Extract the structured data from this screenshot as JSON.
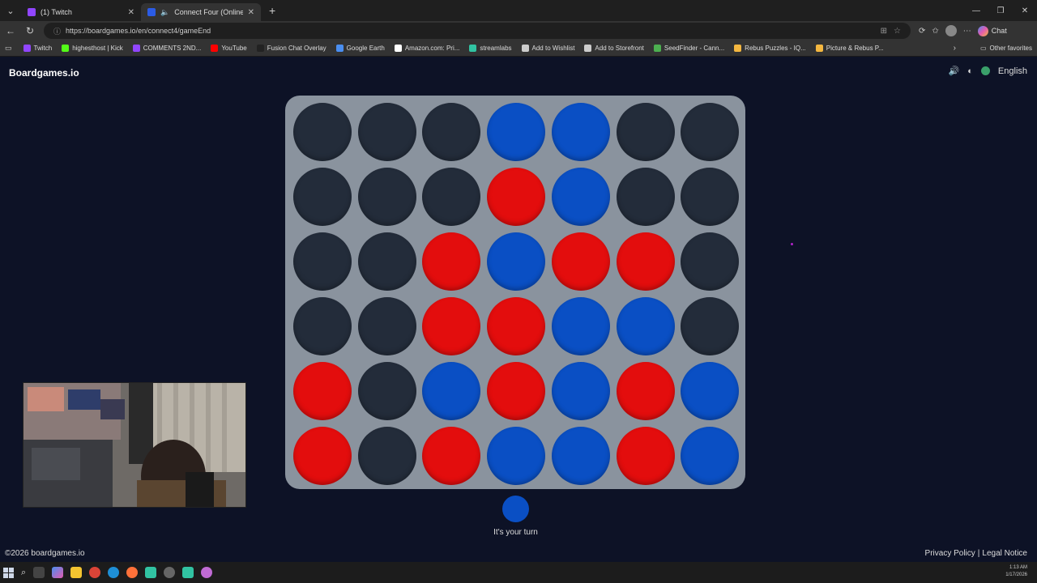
{
  "browser": {
    "tabs": [
      {
        "title": "(1) Twitch",
        "active": false,
        "favicon_color": "#9146ff"
      },
      {
        "title": "Connect Four (Online game f",
        "active": true,
        "favicon_color": "#2b5ce6"
      }
    ],
    "url": "https://boardgames.io/en/connect4/gameEnd",
    "chat_label": "Chat",
    "bookmarks": [
      {
        "label": "Twitch",
        "color": "#9146ff"
      },
      {
        "label": "highesthost | Kick",
        "color": "#53fc18"
      },
      {
        "label": "COMMENTS 2ND...",
        "color": "#9146ff"
      },
      {
        "label": "YouTube",
        "color": "#ff0000"
      },
      {
        "label": "Fusion Chat Overlay",
        "color": "#222222"
      },
      {
        "label": "Google Earth",
        "color": "#4a8ef0"
      },
      {
        "label": "Amazon.com: Pri...",
        "color": "#ffffff"
      },
      {
        "label": "streamlabs",
        "color": "#31c3a2"
      },
      {
        "label": "Add to Wishlist",
        "color": "#cccccc"
      },
      {
        "label": "Add to Storefront",
        "color": "#cccccc"
      },
      {
        "label": "SeedFinder - Cann...",
        "color": "#4caf50"
      },
      {
        "label": "Rebus Puzzles - IQ...",
        "color": "#f4b740"
      },
      {
        "label": "Picture & Rebus P...",
        "color": "#f4b740"
      }
    ],
    "other_favorites": "Other favorites"
  },
  "site": {
    "brand": "Boardgames.io",
    "language": "English",
    "copyright": "©2026 boardgames.io",
    "privacy": "Privacy Policy",
    "separator": "|",
    "legal": "Legal Notice"
  },
  "game": {
    "columns": 7,
    "rows": 6,
    "board": [
      [
        "empty",
        "empty",
        "empty",
        "blue",
        "blue",
        "empty",
        "empty"
      ],
      [
        "empty",
        "empty",
        "empty",
        "red",
        "blue",
        "empty",
        "empty"
      ],
      [
        "empty",
        "empty",
        "red",
        "blue",
        "red",
        "red",
        "empty"
      ],
      [
        "empty",
        "empty",
        "red",
        "red",
        "blue",
        "blue",
        "empty"
      ],
      [
        "red",
        "empty",
        "blue",
        "red",
        "blue",
        "red",
        "blue"
      ],
      [
        "red",
        "empty",
        "red",
        "blue",
        "blue",
        "red",
        "blue"
      ]
    ],
    "turn_color": "blue",
    "turn_text": "It's your turn",
    "colors": {
      "red": "#e30d0d",
      "blue": "#0a4fc4",
      "empty": "#232c3a",
      "board": "#8a939e"
    }
  },
  "taskbar": {
    "time": "1:13 AM",
    "date": "1/17/2026"
  }
}
